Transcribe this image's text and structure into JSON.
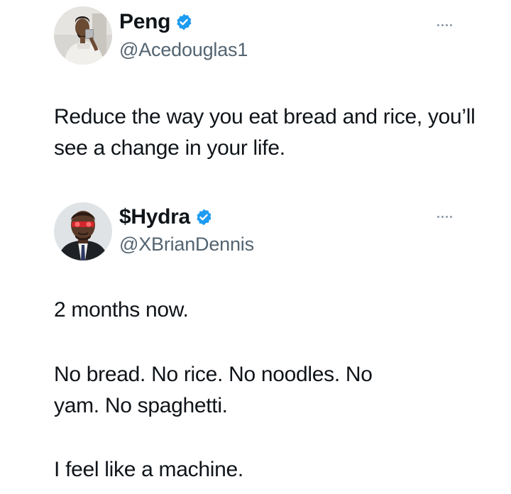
{
  "tweets": [
    {
      "display_name": "Peng",
      "handle": "@Acedouglas1",
      "verified": true,
      "avatar_icon": "user-photo-avatar",
      "paragraphs": [
        "Reduce the way you eat bread and rice, you’ll see a change in your life."
      ]
    },
    {
      "display_name": "$Hydra",
      "handle": "@XBrianDennis",
      "verified": true,
      "avatar_icon": "user-photo-avatar",
      "paragraphs": [
        "2 months now.",
        "No bread. No rice. No noodles. No yam. No spaghetti.",
        "I feel like a machine."
      ]
    }
  ],
  "colors": {
    "text": "#0f1419",
    "handle": "#536471",
    "verified": "#1d9bf0",
    "more_dots": "#8b98a5"
  }
}
